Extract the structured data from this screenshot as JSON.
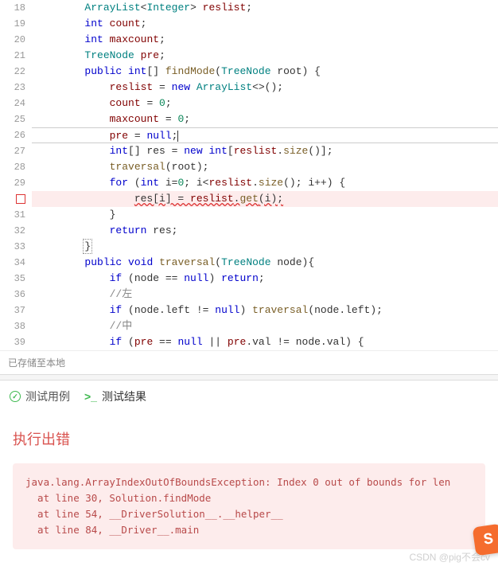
{
  "code_lines": [
    {
      "num": "18",
      "indent": "        ",
      "tokens": [
        [
          "type",
          "ArrayList"
        ],
        [
          "op",
          "<"
        ],
        [
          "type",
          "Integer"
        ],
        [
          "op",
          "> "
        ],
        [
          "field",
          "reslist"
        ],
        [
          "op",
          ";"
        ]
      ]
    },
    {
      "num": "19",
      "indent": "        ",
      "tokens": [
        [
          "kw",
          "int"
        ],
        [
          "op",
          " "
        ],
        [
          "field",
          "count"
        ],
        [
          "op",
          ";"
        ]
      ]
    },
    {
      "num": "20",
      "indent": "        ",
      "tokens": [
        [
          "kw",
          "int"
        ],
        [
          "op",
          " "
        ],
        [
          "field",
          "maxcount"
        ],
        [
          "op",
          ";"
        ]
      ]
    },
    {
      "num": "21",
      "indent": "        ",
      "tokens": [
        [
          "type",
          "TreeNode"
        ],
        [
          "op",
          " "
        ],
        [
          "field",
          "pre"
        ],
        [
          "op",
          ";"
        ]
      ]
    },
    {
      "num": "22",
      "indent": "        ",
      "tokens": [
        [
          "kw",
          "public"
        ],
        [
          "op",
          " "
        ],
        [
          "kw",
          "int"
        ],
        [
          "op",
          "[] "
        ],
        [
          "fn",
          "findMode"
        ],
        [
          "op",
          "("
        ],
        [
          "type",
          "TreeNode"
        ],
        [
          "op",
          " root) {"
        ]
      ]
    },
    {
      "num": "23",
      "indent": "            ",
      "tokens": [
        [
          "field",
          "reslist"
        ],
        [
          "op",
          " = "
        ],
        [
          "kw",
          "new"
        ],
        [
          "op",
          " "
        ],
        [
          "type",
          "ArrayList"
        ],
        [
          "op",
          "<>();"
        ]
      ]
    },
    {
      "num": "24",
      "indent": "            ",
      "tokens": [
        [
          "field",
          "count"
        ],
        [
          "op",
          " = "
        ],
        [
          "num",
          "0"
        ],
        [
          "op",
          ";"
        ]
      ]
    },
    {
      "num": "25",
      "indent": "            ",
      "tokens": [
        [
          "field",
          "maxcount"
        ],
        [
          "op",
          " = "
        ],
        [
          "num",
          "0"
        ],
        [
          "op",
          ";"
        ]
      ]
    },
    {
      "num": "26",
      "indent": "            ",
      "tokens": [
        [
          "field",
          "pre"
        ],
        [
          "op",
          " = "
        ],
        [
          "kw",
          "null"
        ],
        [
          "op",
          ";"
        ]
      ],
      "caret": true,
      "current": true
    },
    {
      "num": "27",
      "indent": "            ",
      "tokens": [
        [
          "kw",
          "int"
        ],
        [
          "op",
          "[] res = "
        ],
        [
          "kw",
          "new"
        ],
        [
          "op",
          " "
        ],
        [
          "kw",
          "int"
        ],
        [
          "op",
          "["
        ],
        [
          "field",
          "reslist"
        ],
        [
          "op",
          "."
        ],
        [
          "fn2",
          "size"
        ],
        [
          "op",
          "()];"
        ]
      ]
    },
    {
      "num": "28",
      "indent": "            ",
      "tokens": [
        [
          "fn2",
          "traversal"
        ],
        [
          "op",
          "(root);"
        ]
      ]
    },
    {
      "num": "29",
      "indent": "            ",
      "tokens": [
        [
          "kw",
          "for"
        ],
        [
          "op",
          " ("
        ],
        [
          "kw",
          "int"
        ],
        [
          "op",
          " i="
        ],
        [
          "num",
          "0"
        ],
        [
          "op",
          "; i<"
        ],
        [
          "field",
          "reslist"
        ],
        [
          "op",
          "."
        ],
        [
          "fn2",
          "size"
        ],
        [
          "op",
          "(); i++) {"
        ]
      ]
    },
    {
      "num": "err",
      "indent": "                ",
      "tokens": [
        [
          "op",
          "res[i] = "
        ],
        [
          "field",
          "reslist"
        ],
        [
          "op",
          "."
        ],
        [
          "fn2",
          "get"
        ],
        [
          "op",
          "(i);"
        ]
      ],
      "error": true
    },
    {
      "num": "31",
      "indent": "            ",
      "tokens": [
        [
          "op",
          "}"
        ]
      ]
    },
    {
      "num": "32",
      "indent": "            ",
      "tokens": [
        [
          "kw",
          "return"
        ],
        [
          "op",
          " res;"
        ]
      ]
    },
    {
      "num": "33",
      "indent": "        ",
      "tokens": [
        [
          "op",
          "}"
        ]
      ],
      "boxend": true
    },
    {
      "num": "34",
      "indent": "        ",
      "tokens": [
        [
          "kw",
          "public"
        ],
        [
          "op",
          " "
        ],
        [
          "kw",
          "void"
        ],
        [
          "op",
          " "
        ],
        [
          "fn",
          "traversal"
        ],
        [
          "op",
          "("
        ],
        [
          "type",
          "TreeNode"
        ],
        [
          "op",
          " node){"
        ]
      ]
    },
    {
      "num": "35",
      "indent": "            ",
      "tokens": [
        [
          "kw",
          "if"
        ],
        [
          "op",
          " (node == "
        ],
        [
          "kw",
          "null"
        ],
        [
          "op",
          ") "
        ],
        [
          "kw",
          "return"
        ],
        [
          "op",
          ";"
        ]
      ]
    },
    {
      "num": "36",
      "indent": "            ",
      "tokens": [
        [
          "comment",
          "//左"
        ]
      ]
    },
    {
      "num": "37",
      "indent": "            ",
      "tokens": [
        [
          "kw",
          "if"
        ],
        [
          "op",
          " (node.left != "
        ],
        [
          "kw",
          "null"
        ],
        [
          "op",
          ") "
        ],
        [
          "fn2",
          "traversal"
        ],
        [
          "op",
          "(node.left);"
        ]
      ]
    },
    {
      "num": "38",
      "indent": "            ",
      "tokens": [
        [
          "comment",
          "//中"
        ]
      ]
    },
    {
      "num": "39",
      "indent": "            ",
      "tokens": [
        [
          "kw",
          "if"
        ],
        [
          "op",
          " ("
        ],
        [
          "field",
          "pre"
        ],
        [
          "op",
          " == "
        ],
        [
          "kw",
          "null"
        ],
        [
          "op",
          " || "
        ],
        [
          "field",
          "pre"
        ],
        [
          "op",
          ".val != node.val) {"
        ]
      ]
    }
  ],
  "saved_text": "已存储至本地",
  "tabs": {
    "testcase": "测试用例",
    "result": "测试结果"
  },
  "error": {
    "title": "执行出错",
    "trace": "java.lang.ArrayIndexOutOfBoundsException: Index 0 out of bounds for len\n  at line 30, Solution.findMode\n  at line 54, __DriverSolution__.__helper__\n  at line 84, __Driver__.main"
  },
  "watermark": "CSDN @pig不会cv",
  "badge": "S"
}
